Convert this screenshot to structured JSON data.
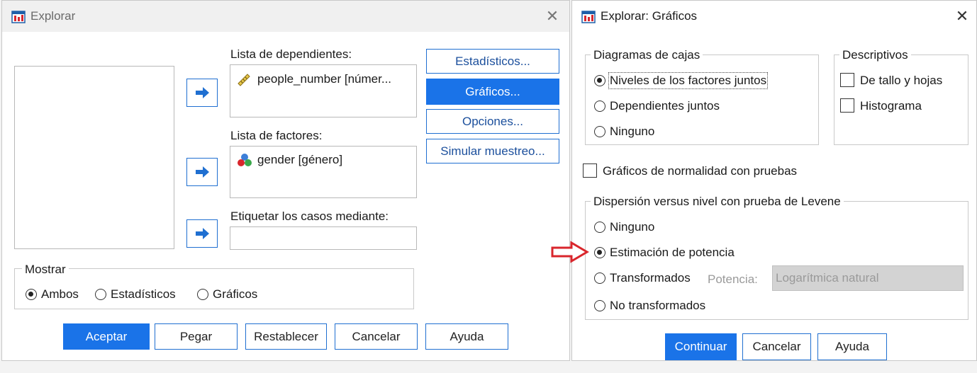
{
  "left_dialog": {
    "title": "Explorar",
    "dependents_label": "Lista de dependientes:",
    "dependent_item": "people_number [númer...",
    "factors_label": "Lista de factores:",
    "factor_item": "gender [género]",
    "label_cases_label": "Etiquetar los casos mediante:",
    "side_buttons": {
      "stats": "Estadísticos...",
      "plots": "Gráficos...",
      "options": "Opciones...",
      "simulate": "Simular muestreo..."
    },
    "display_group": {
      "label": "Mostrar",
      "both": "Ambos",
      "stats": "Estadísticos",
      "plots": "Gráficos",
      "selected": "both"
    },
    "bottom_buttons": {
      "ok": "Aceptar",
      "paste": "Pegar",
      "reset": "Restablecer",
      "cancel": "Cancelar",
      "help": "Ayuda"
    }
  },
  "right_dialog": {
    "title": "Explorar: Gráficos",
    "boxplots": {
      "label": "Diagramas de cajas",
      "opt1": "Niveles de los factores juntos",
      "opt2": "Dependientes juntos",
      "opt3": "Ninguno",
      "selected": "opt1"
    },
    "descriptives": {
      "label": "Descriptivos",
      "stem_leaf": "De tallo y hojas",
      "histogram": "Histograma"
    },
    "normality_label": "Gráficos de normalidad con pruebas",
    "spread": {
      "label": "Dispersión versus nivel con prueba de Levene",
      "none": "Ninguno",
      "power": "Estimación de potencia",
      "transformed": "Transformados",
      "power_label": "Potencia:",
      "power_value": "Logarítmica natural",
      "untransformed": "No transformados",
      "selected": "power"
    },
    "buttons": {
      "continue": "Continuar",
      "cancel": "Cancelar",
      "help": "Ayuda"
    }
  },
  "colors": {
    "accent": "#1a73e8",
    "annotation_arrow": "#d9262c"
  },
  "icons": [
    "app-icon",
    "close-icon",
    "arrow-right-icon",
    "ruler-icon",
    "nominal-icon"
  ]
}
